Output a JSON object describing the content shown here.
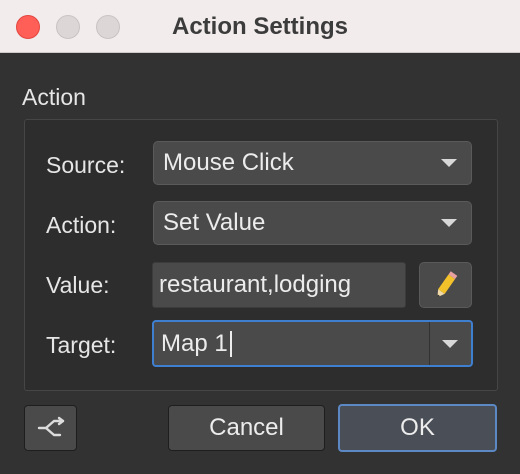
{
  "window": {
    "title": "Action Settings"
  },
  "group": {
    "title": "Action"
  },
  "form": {
    "source": {
      "label": "Source:",
      "value": "Mouse Click"
    },
    "action": {
      "label": "Action:",
      "value": "Set Value"
    },
    "value": {
      "label": "Value:",
      "value": "restaurant,lodging"
    },
    "target": {
      "label": "Target:",
      "value": "Map 1"
    }
  },
  "buttons": {
    "cancel": "Cancel",
    "ok": "OK"
  },
  "icons": {
    "pencil": "pencil-icon",
    "transition": "transition-icon"
  },
  "colors": {
    "close_button": "#ff5f57",
    "focus_ring": "#3f7fd0",
    "pencil": "#f3c12a"
  }
}
